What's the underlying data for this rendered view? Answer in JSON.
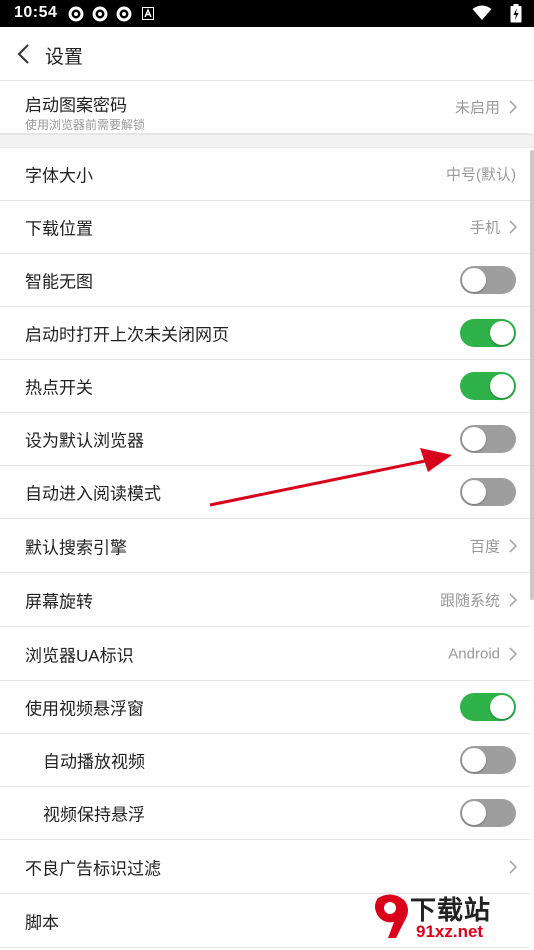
{
  "status_bar": {
    "time": "10:54"
  },
  "header": {
    "title": "设置"
  },
  "colors": {
    "accent_green": "#2fb24a",
    "toggle_off": "#9e9e9e",
    "arrow_red": "#d9001b"
  },
  "pattern_lock": {
    "label": "启动图案密码",
    "sub": "使用浏览器前需要解锁",
    "value": "未启用"
  },
  "settings": [
    {
      "name": "font-size",
      "label": "字体大小",
      "value": "中号(默认)"
    },
    {
      "name": "download-location",
      "label": "下载位置",
      "value": "手机"
    },
    {
      "name": "smart-no-image",
      "label": "智能无图",
      "toggle": false
    },
    {
      "name": "restore-tabs",
      "label": "启动时打开上次未关闭网页",
      "toggle": true
    },
    {
      "name": "hotspot",
      "label": "热点开关",
      "toggle": true
    },
    {
      "name": "default-browser",
      "label": "设为默认浏览器",
      "toggle": false
    },
    {
      "name": "auto-reader-mode",
      "label": "自动进入阅读模式",
      "toggle": false
    },
    {
      "name": "search-engine",
      "label": "默认搜索引擎",
      "value": "百度"
    },
    {
      "name": "screen-rotation",
      "label": "屏幕旋转",
      "value": "跟随系统"
    },
    {
      "name": "user-agent",
      "label": "浏览器UA标识",
      "value": "Android"
    },
    {
      "name": "video-float",
      "label": "使用视频悬浮窗",
      "toggle": true
    },
    {
      "name": "autoplay-video",
      "label": "自动播放视频",
      "toggle": false
    },
    {
      "name": "keep-video-float",
      "label": "视频保持悬浮",
      "toggle": false
    },
    {
      "name": "ad-filter",
      "label": "不良广告标识过滤"
    },
    {
      "name": "scripts",
      "label": "脚本"
    }
  ],
  "watermark": {
    "text": "下载站",
    "url": "91xz.net"
  }
}
